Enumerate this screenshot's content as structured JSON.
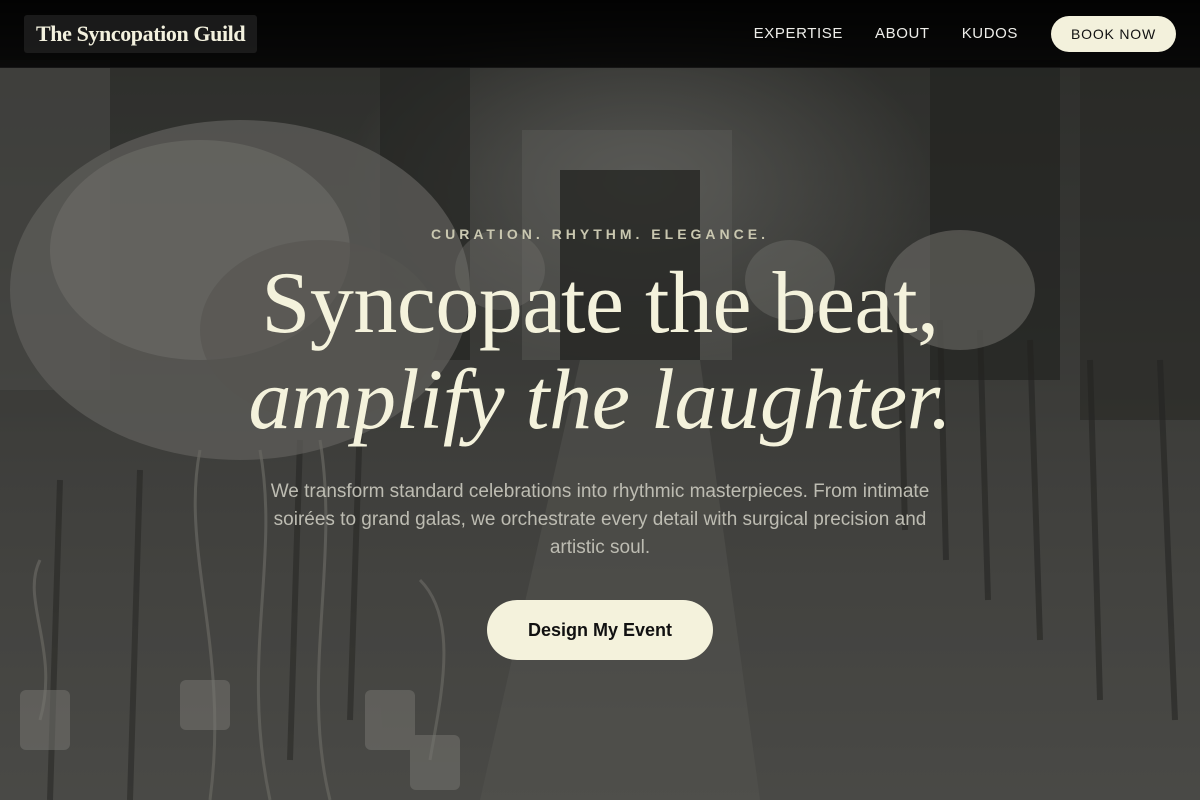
{
  "brand": {
    "name": "The Syncopation Guild"
  },
  "nav": {
    "links": [
      "EXPERTISE",
      "ABOUT",
      "KUDOS"
    ],
    "cta_label": "BOOK NOW"
  },
  "hero": {
    "eyebrow": "CURATION. RHYTHM. ELEGANCE.",
    "headline_line1": "Syncopate the beat,",
    "headline_line2": "amplify the laughter.",
    "subtext": "We transform standard celebrations into rhythmic masterpieces. From intimate soirées to grand galas, we orchestrate every detail with surgical precision and artistic soul.",
    "cta_label": "Design My Event"
  },
  "colors": {
    "accent_cream": "#f4f2dc",
    "nav_background": "#000000",
    "eyebrow_text": "#c9c7b0"
  }
}
